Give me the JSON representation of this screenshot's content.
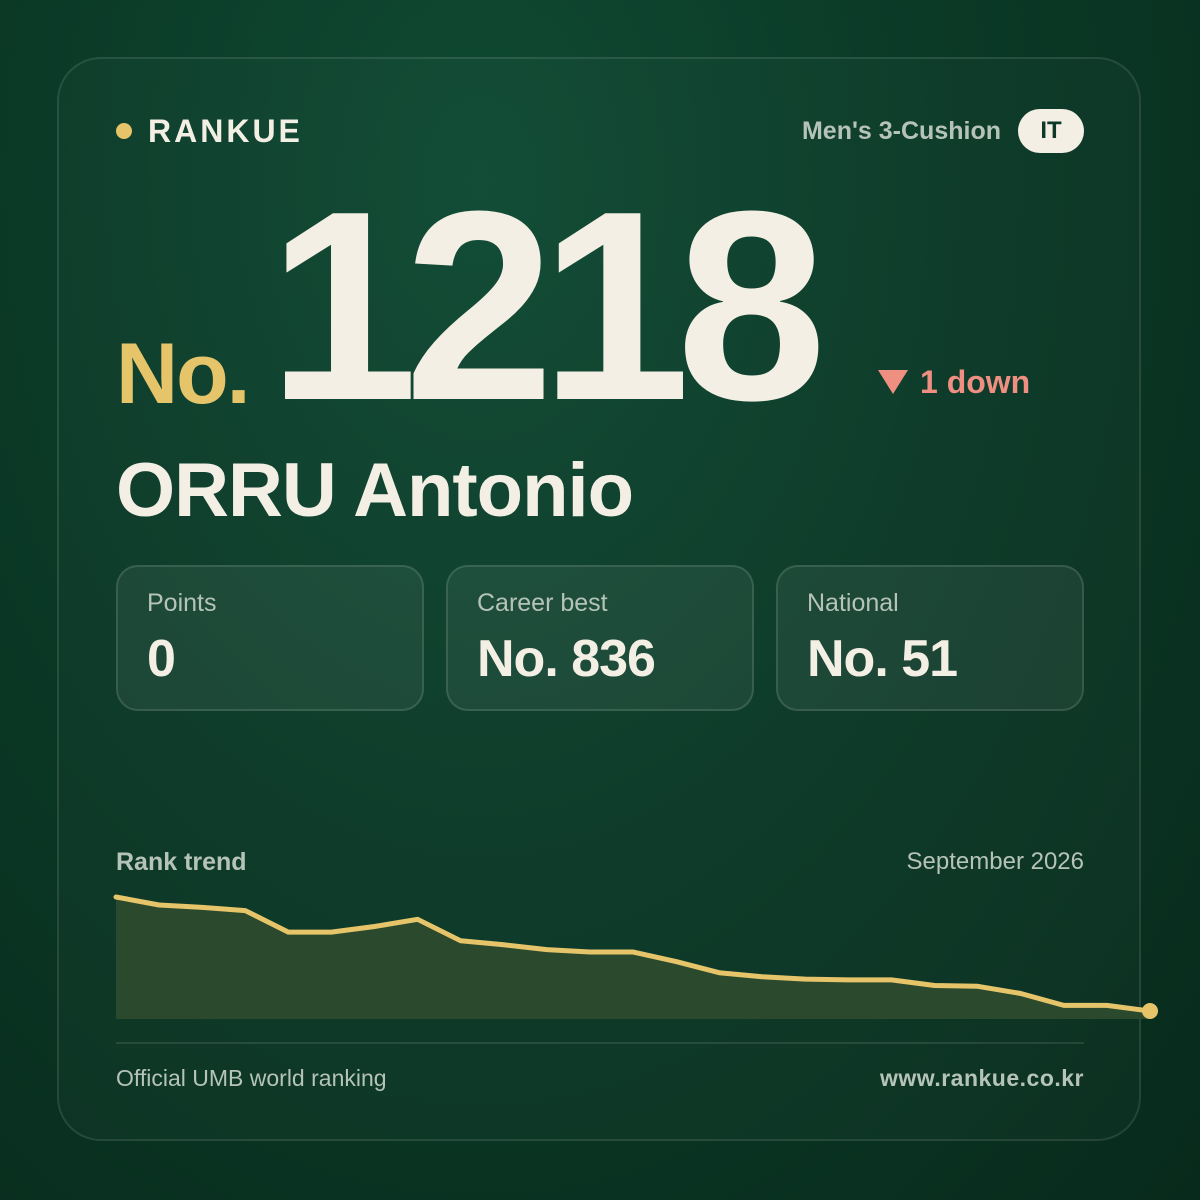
{
  "brand": {
    "name": "RANKUE"
  },
  "header": {
    "category": "Men's 3-Cushion",
    "country": "IT"
  },
  "rank": {
    "prefix": "No.",
    "value": "1218",
    "change": "1 down",
    "direction": "down"
  },
  "player": {
    "name": "ORRU Antonio"
  },
  "stats": [
    {
      "label": "Points",
      "value": "0"
    },
    {
      "label": "Career best",
      "value": "No. 836"
    },
    {
      "label": "National",
      "value": "No. 51"
    }
  ],
  "trend": {
    "title": "Rank trend",
    "date": "September 2026"
  },
  "footer": {
    "source": "Official UMB world ranking",
    "url": "www.rankue.co.kr"
  },
  "colors": {
    "accent": "#e6c56a",
    "down": "#ef8f82",
    "text": "#f4efe4",
    "muted": "#b5c3b9"
  },
  "chart_data": {
    "type": "area",
    "title": "Rank trend",
    "inverted": true,
    "series": [
      {
        "values": [
          1000,
          1010,
          1013,
          1017,
          1044,
          1044,
          1037,
          1028,
          1055,
          1060,
          1066,
          1069,
          1069,
          1081,
          1095,
          1100,
          1103,
          1104,
          1104,
          1111,
          1112,
          1121,
          1136,
          1136,
          1143
        ]
      }
    ]
  }
}
